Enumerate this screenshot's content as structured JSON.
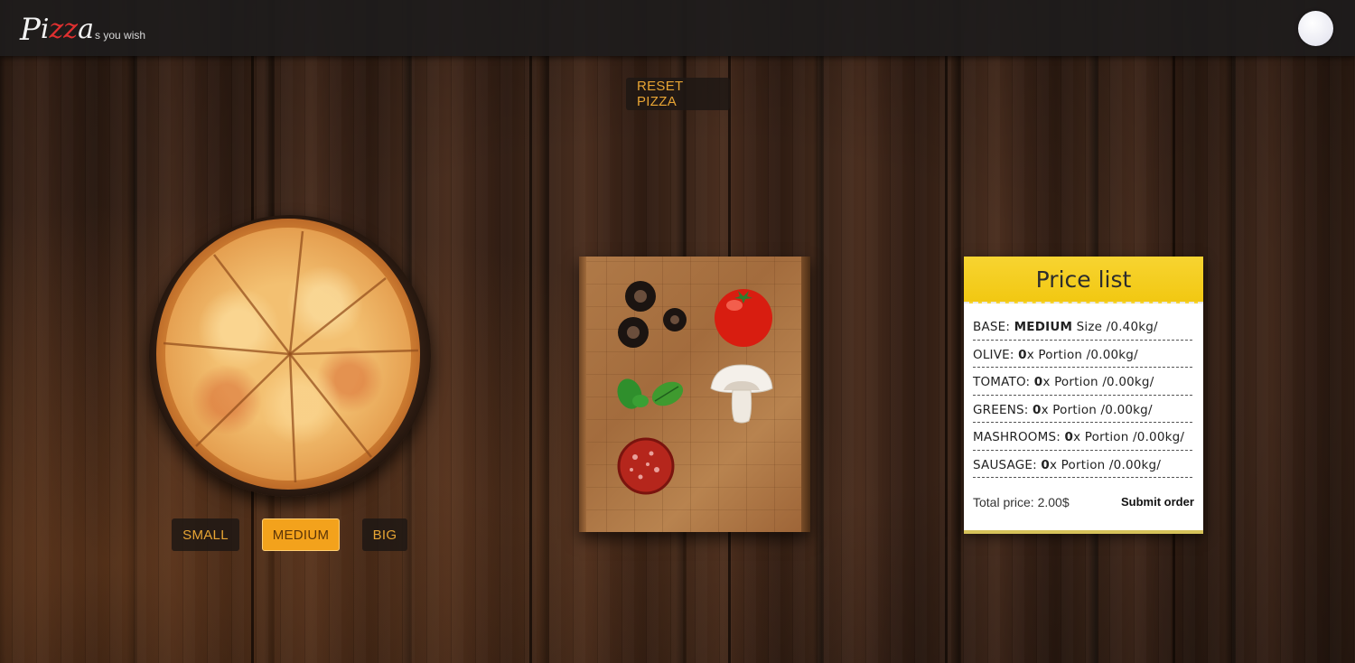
{
  "header": {
    "logo": {
      "first_letter": "P",
      "i": "i",
      "z": "zz",
      "a": "a",
      "tagline": "s you wish"
    }
  },
  "actions": {
    "reset_label": "RESET PIZZA"
  },
  "sizes": {
    "selected": "MEDIUM",
    "options": [
      "SMALL",
      "MEDIUM",
      "BIG"
    ]
  },
  "ingredients": [
    "olive",
    "tomato",
    "greens",
    "mushroom",
    "sausage"
  ],
  "price_list": {
    "title": "Price list",
    "base": {
      "label": "BASE:",
      "value": "MEDIUM",
      "unit": "Size",
      "weight": "/0.40kg/"
    },
    "rows": [
      {
        "label": "OLIVE:",
        "qty": "0",
        "suffix": "x Portion",
        "weight": "/0.00kg/"
      },
      {
        "label": "TOMATO:",
        "qty": "0",
        "suffix": "x Portion",
        "weight": "/0.00kg/"
      },
      {
        "label": "GREENS:",
        "qty": "0",
        "suffix": "x Portion",
        "weight": "/0.00kg/"
      },
      {
        "label": "MASHROOMS:",
        "qty": "0",
        "suffix": "x Portion",
        "weight": "/0.00kg/"
      },
      {
        "label": "SAUSAGE:",
        "qty": "0",
        "suffix": "x Portion",
        "weight": "/0.00kg/"
      }
    ],
    "total": "Total price: 2.00$",
    "submit_label": "Submit order"
  },
  "colors": {
    "accent": "#f3a21c",
    "header_bg": "#1e1c1c",
    "price_header": "#f2c812",
    "logo_red": "#e03030"
  }
}
